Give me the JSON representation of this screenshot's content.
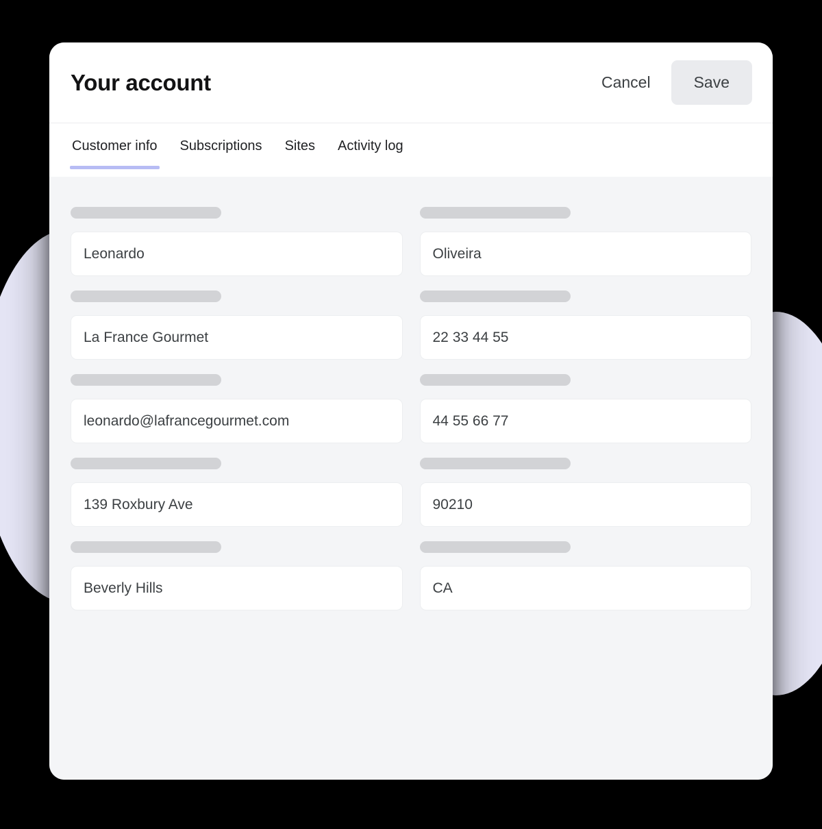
{
  "header": {
    "title": "Your account",
    "cancel_label": "Cancel",
    "save_label": "Save"
  },
  "tabs": [
    {
      "label": "Customer info",
      "active": true
    },
    {
      "label": "Subscriptions",
      "active": false
    },
    {
      "label": "Sites",
      "active": false
    },
    {
      "label": "Activity log",
      "active": false
    }
  ],
  "form": {
    "fields": [
      {
        "name": "first-name",
        "value": "Leonardo"
      },
      {
        "name": "last-name",
        "value": "Oliveira"
      },
      {
        "name": "company",
        "value": "La France Gourmet"
      },
      {
        "name": "phone-primary",
        "value": "22 33 44 55"
      },
      {
        "name": "email",
        "value": "leonardo@lafrancegourmet.com"
      },
      {
        "name": "phone-secondary",
        "value": "44 55 66 77"
      },
      {
        "name": "street-address",
        "value": "139 Roxbury Ave"
      },
      {
        "name": "postal-code",
        "value": "90210"
      },
      {
        "name": "city",
        "value": "Beverly Hills"
      },
      {
        "name": "state",
        "value": "CA"
      }
    ]
  },
  "colors": {
    "accent": "#b7bcf4",
    "halo": "#e5e5f5",
    "body_background": "#f4f5f7",
    "skeleton": "#d2d3d6",
    "save_button": "#eaebee"
  }
}
